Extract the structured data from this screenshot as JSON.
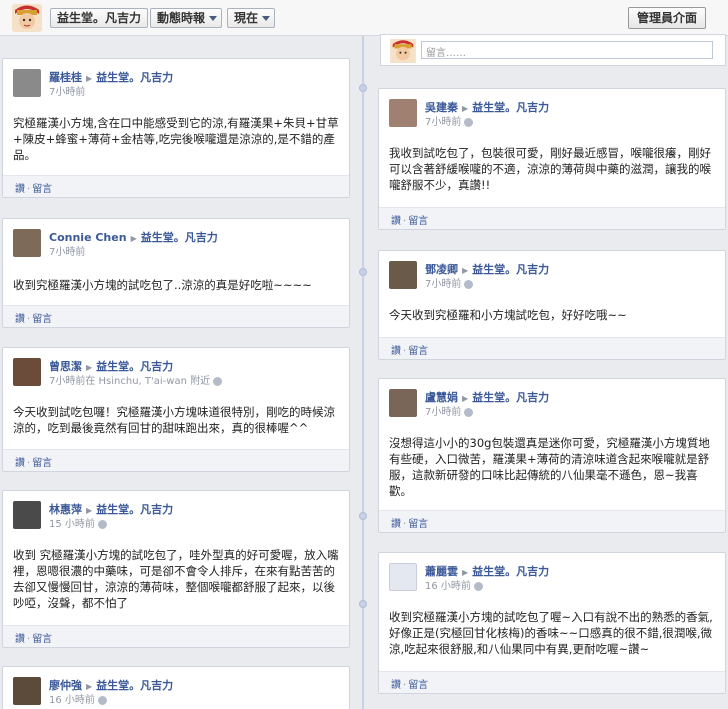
{
  "header": {
    "page_name": "益生堂。凡吉力",
    "activity_menu": "動態時報",
    "now_menu": "現在",
    "admin_button": "管理員介面"
  },
  "composer": {
    "placeholder": "留言……"
  },
  "actions": {
    "like": "讚",
    "sep": "·",
    "comment": "留言"
  },
  "left_posts": [
    {
      "author": "羅桂桂",
      "target": "益生堂。凡吉力",
      "time": "7小時前",
      "body": "究極羅漢小方塊,含在口中能感受到它的涼,有羅漢果+朱貝+甘草+陳皮+蜂蜜+薄荷+金桔等,吃完後喉嚨還是涼涼的,是不錯的產品。"
    },
    {
      "author": "Connie Chen",
      "target": "益生堂。凡吉力",
      "time": "7小時前",
      "body": "收到究極羅漢小方塊的試吃包了..涼涼的真是好吃啦~~~~"
    },
    {
      "author": "曾思潔",
      "target": "益生堂。凡吉力",
      "time": "7小時前在 Hsinchu, T'ai-wan 附近",
      "body": "今天收到試吃包囉！究極羅漢小方塊味道很特別，剛吃的時候涼涼的，吃到最後竟然有回甘的甜味跑出來，真的很棒喔^^"
    },
    {
      "author": "林惠萍",
      "target": "益生堂。凡吉力",
      "time": "15 小時前",
      "body": "收到 究極羅漢小方塊的試吃包了，哇外型真的好可愛喔，放入嘴裡，恩嗯很濃的中藥味，可是卻不會令人排斥，在來有點苦苦的去卻又慢慢回甘，涼涼的薄荷味，整個喉嚨都舒服了起來，以後吵啞，沒聲，都不怕了"
    },
    {
      "author": "廖仲強",
      "target": "益生堂。凡吉力",
      "time": "16 小時前",
      "body": ""
    }
  ],
  "right_posts": [
    {
      "author": "吳建秦",
      "target": "益生堂。凡吉力",
      "time": "7小時前",
      "body": "我收到試吃包了，包裝很可愛，剛好最近感冒，喉嚨很癢，剛好可以含著舒緩喉嚨的不適，涼涼的薄荷與中藥的滋潤，讓我的喉嚨舒服不少，真讚!!"
    },
    {
      "author": "鄧凌卿",
      "target": "益生堂。凡吉力",
      "time": "7小時前",
      "body": "今天收到究極羅和小方塊試吃包，好好吃哦~~"
    },
    {
      "author": "盧慧娟",
      "target": "益生堂。凡吉力",
      "time": "7小時前",
      "body": "沒想得這小小的30g包裝還真是迷你可愛，究極羅漢小方塊質地有些硬，入口微苦，羅漢果+薄荷的清涼味道含起來喉嚨就是舒服，這款新研發的口味比起傳統的八仙果毫不遜色，恩~我喜歡。"
    },
    {
      "author": "蕭麗雲",
      "target": "益生堂。凡吉力",
      "time": "16 小時前",
      "body": "收到究極羅漢小方塊的試吃包了喔~入口有說不出的熟悉的香氣,好像正是(究極回甘化核梅)的香味~~口感真的很不錯,很潤喉,微涼,吃起來很舒服,和八仙果同中有異,更耐吃喔~讚~"
    }
  ],
  "colors": {
    "link": "#3b5998",
    "background": "#e9ebee",
    "meta": "#9197a3"
  }
}
